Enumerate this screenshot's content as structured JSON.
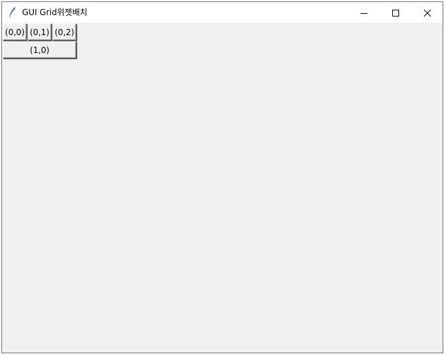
{
  "window": {
    "title": "GUI Grid위젯배치",
    "icon": "feather-icon",
    "controls": {
      "minimize": "minimize-icon",
      "maximize": "maximize-icon",
      "close": "close-icon"
    }
  },
  "grid": {
    "buttons": [
      {
        "label": "(0,0)"
      },
      {
        "label": "(0,1)"
      },
      {
        "label": "(0,2)"
      },
      {
        "label": "(1,0)"
      }
    ]
  },
  "colors": {
    "titlebar": "#ffffff",
    "client_background": "#f0f0f0"
  }
}
